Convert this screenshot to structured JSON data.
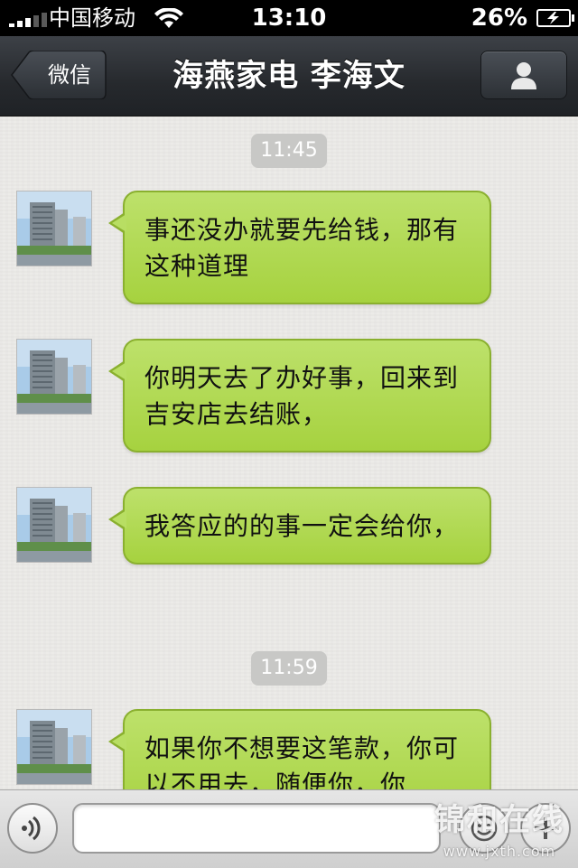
{
  "status_bar": {
    "carrier": "中国移动",
    "time": "13:10",
    "battery": "26%",
    "icons": [
      "signal-icon",
      "wifi-icon",
      "battery-charging-icon"
    ]
  },
  "nav": {
    "back_label": "微信",
    "title": "海燕家电 李海文",
    "profile_icon": "person-icon"
  },
  "chat": {
    "timestamps": [
      "11:45",
      "11:59"
    ],
    "messages": [
      {
        "sender": "contact",
        "text": "事还没办就要先给钱，那有这种道理"
      },
      {
        "sender": "contact",
        "text": "你明天去了办好事，回来到吉安店去结账，"
      },
      {
        "sender": "contact",
        "text": "我答应的的事一定会给你，"
      },
      {
        "sender": "contact",
        "text": "如果你不想要这笔款，你可以不用去，随便你，你"
      }
    ]
  },
  "input_bar": {
    "voice_icon": "voice-icon",
    "text_value": "",
    "emoji_icon": "emoji-icon",
    "plus_icon": "plus-icon"
  },
  "watermark": {
    "text": "锦和在线",
    "url": "www.jxth.com"
  },
  "colors": {
    "bubble": "#a6d23f",
    "navbar": "#26292d",
    "status_bar": "#000000"
  }
}
